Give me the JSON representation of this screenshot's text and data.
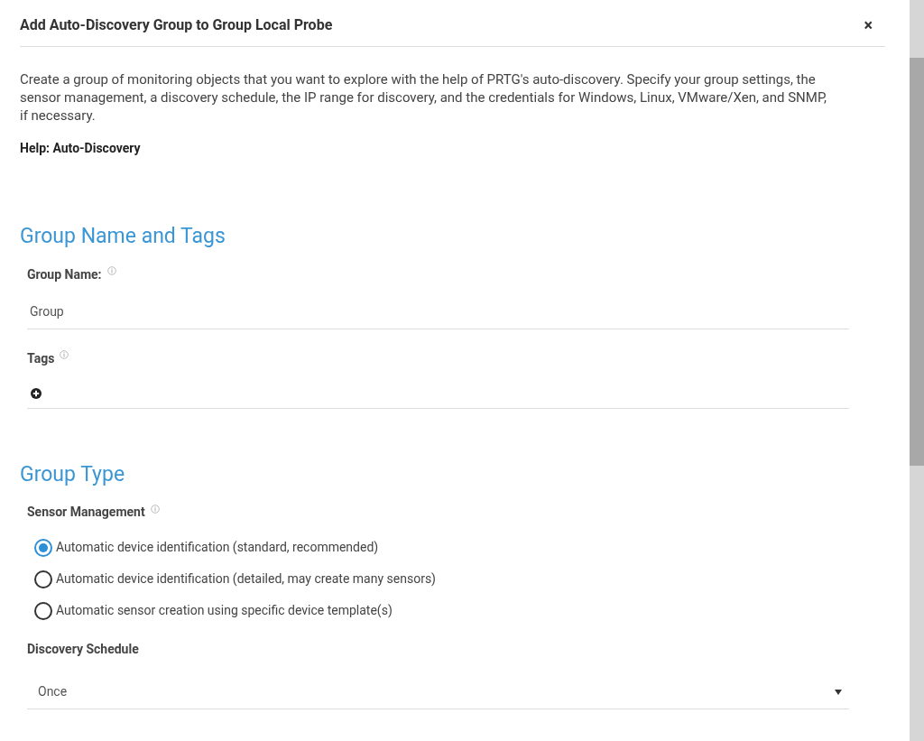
{
  "dialog": {
    "title": "Add Auto-Discovery Group to Group Local Probe",
    "close": "×"
  },
  "description": "Create a group of monitoring objects that you want to explore with the help of PRTG's auto-discovery. Specify your group settings, the sensor management, a discovery schedule, the IP range for discovery, and the credentials for Windows, Linux, VMware/Xen, and SNMP, if necessary.",
  "help_link": "Help: Auto-Discovery",
  "sections": [
    {
      "heading": "Group Name and Tags",
      "fields": [
        {
          "kind": "text",
          "label": "Group Name:",
          "info": true,
          "value": "Group"
        },
        {
          "kind": "tags",
          "label": "Tags",
          "info": true
        }
      ]
    },
    {
      "heading": "Group Type",
      "fields": [
        {
          "kind": "radio",
          "label": "Sensor Management",
          "info": true,
          "options": [
            {
              "label": "Automatic device identification (standard, recommended)",
              "selected": true
            },
            {
              "label": "Automatic device identification (detailed, may create many sensors)",
              "selected": false
            },
            {
              "label": "Automatic sensor creation using specific device template(s)",
              "selected": false
            }
          ]
        },
        {
          "kind": "select",
          "label": "Discovery Schedule",
          "info": false,
          "value": "Once"
        }
      ]
    }
  ]
}
